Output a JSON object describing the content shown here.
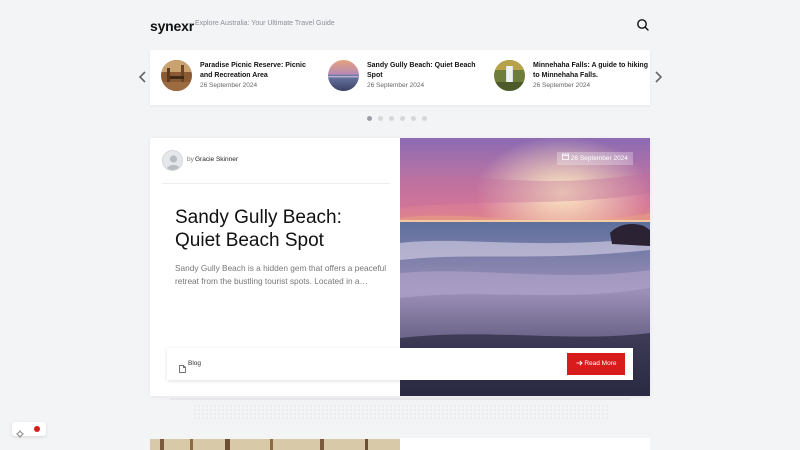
{
  "site": {
    "logo": "synexr",
    "tagline": "Explore Australia: Your Ultimate Travel Guide"
  },
  "carousel": {
    "items": [
      {
        "title": "Paradise Picnic Reserve: Picnic and Recreation Area",
        "date": "26 September 2024"
      },
      {
        "title": "Sandy Gully Beach: Quiet Beach Spot",
        "date": "26 September 2024"
      },
      {
        "title": "Minnehaha Falls: A guide to hiking to Minnehaha Falls.",
        "date": "26 September 2024"
      }
    ],
    "page_count": 6,
    "active_page": 1
  },
  "featured": {
    "author_prefix": "by",
    "author": "Gracie Skinner",
    "date": "26 September 2024",
    "title": "Sandy Gully Beach: Quiet Beach Spot",
    "excerpt": "Sandy Gully Beach is a hidden gem that offers a peaceful retreat from the bustling tourist spots. Located in a…",
    "category": "Blog",
    "read_more": "Read More"
  },
  "icons": {
    "search": "search-icon",
    "prev": "chevron-left-icon",
    "next": "chevron-right-icon",
    "calendar": "calendar-icon",
    "category": "document-icon",
    "arrow": "arrow-right-icon",
    "theme": "gear-icon"
  },
  "colors": {
    "accent": "#d81b1b",
    "background": "#f3f4f6",
    "card": "#ffffff"
  }
}
